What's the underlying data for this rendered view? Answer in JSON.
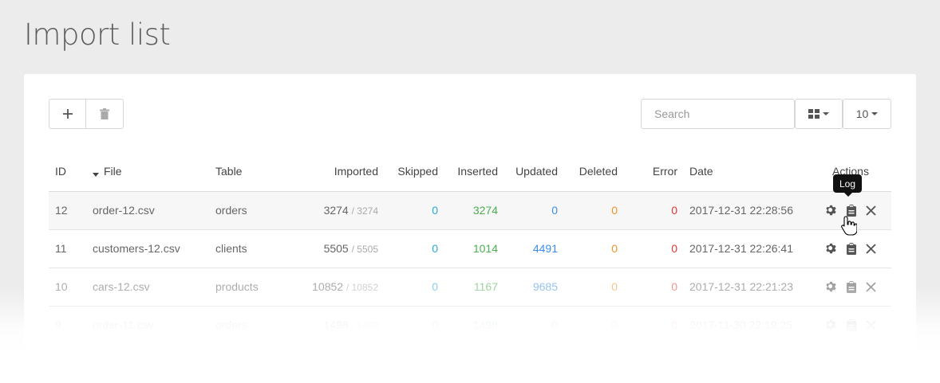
{
  "page": {
    "title": "Import list"
  },
  "toolbar": {
    "add_icon": "plus-icon",
    "delete_icon": "trash-icon",
    "search_placeholder": "Search",
    "view_icon": "grid-icon",
    "page_size": "10"
  },
  "table": {
    "columns": {
      "id": "ID",
      "file": "File",
      "table": "Table",
      "imported": "Imported",
      "skipped": "Skipped",
      "inserted": "Inserted",
      "updated": "Updated",
      "deleted": "Deleted",
      "error": "Error",
      "date": "Date",
      "actions": "Actions"
    },
    "sorted_column": "File",
    "rows": [
      {
        "id": "12",
        "file": "order-12.csv",
        "table": "orders",
        "imported": "3274",
        "imported_total": "/ 3274",
        "skipped": "0",
        "inserted": "3274",
        "updated": "0",
        "deleted": "0",
        "error": "0",
        "date": "2017-12-31 22:28:56"
      },
      {
        "id": "11",
        "file": "customers-12.csv",
        "table": "clients",
        "imported": "5505",
        "imported_total": "/ 5505",
        "skipped": "0",
        "inserted": "1014",
        "updated": "4491",
        "deleted": "0",
        "error": "0",
        "date": "2017-12-31 22:26:41"
      },
      {
        "id": "10",
        "file": "cars-12.csv",
        "table": "products",
        "imported": "10852",
        "imported_total": "/ 10852",
        "skipped": "0",
        "inserted": "1167",
        "updated": "9685",
        "deleted": "0",
        "error": "0",
        "date": "2017-12-31 22:21:23"
      },
      {
        "id": "9",
        "file": "order-11.csv",
        "table": "orders",
        "imported": "1498",
        "imported_total": "/ 1498",
        "skipped": "0",
        "inserted": "1498",
        "updated": "0",
        "deleted": "0",
        "error": "0",
        "date": "2017-11-30 22:19:25"
      }
    ],
    "row_actions": [
      "settings-icon",
      "log-icon",
      "close-icon"
    ]
  },
  "tooltip": {
    "text": "Log"
  },
  "colors": {
    "skipped": "#29a8d6",
    "inserted": "#4caf50",
    "updated": "#3d8ee8",
    "deleted": "#f0932b",
    "error": "#e53935"
  }
}
